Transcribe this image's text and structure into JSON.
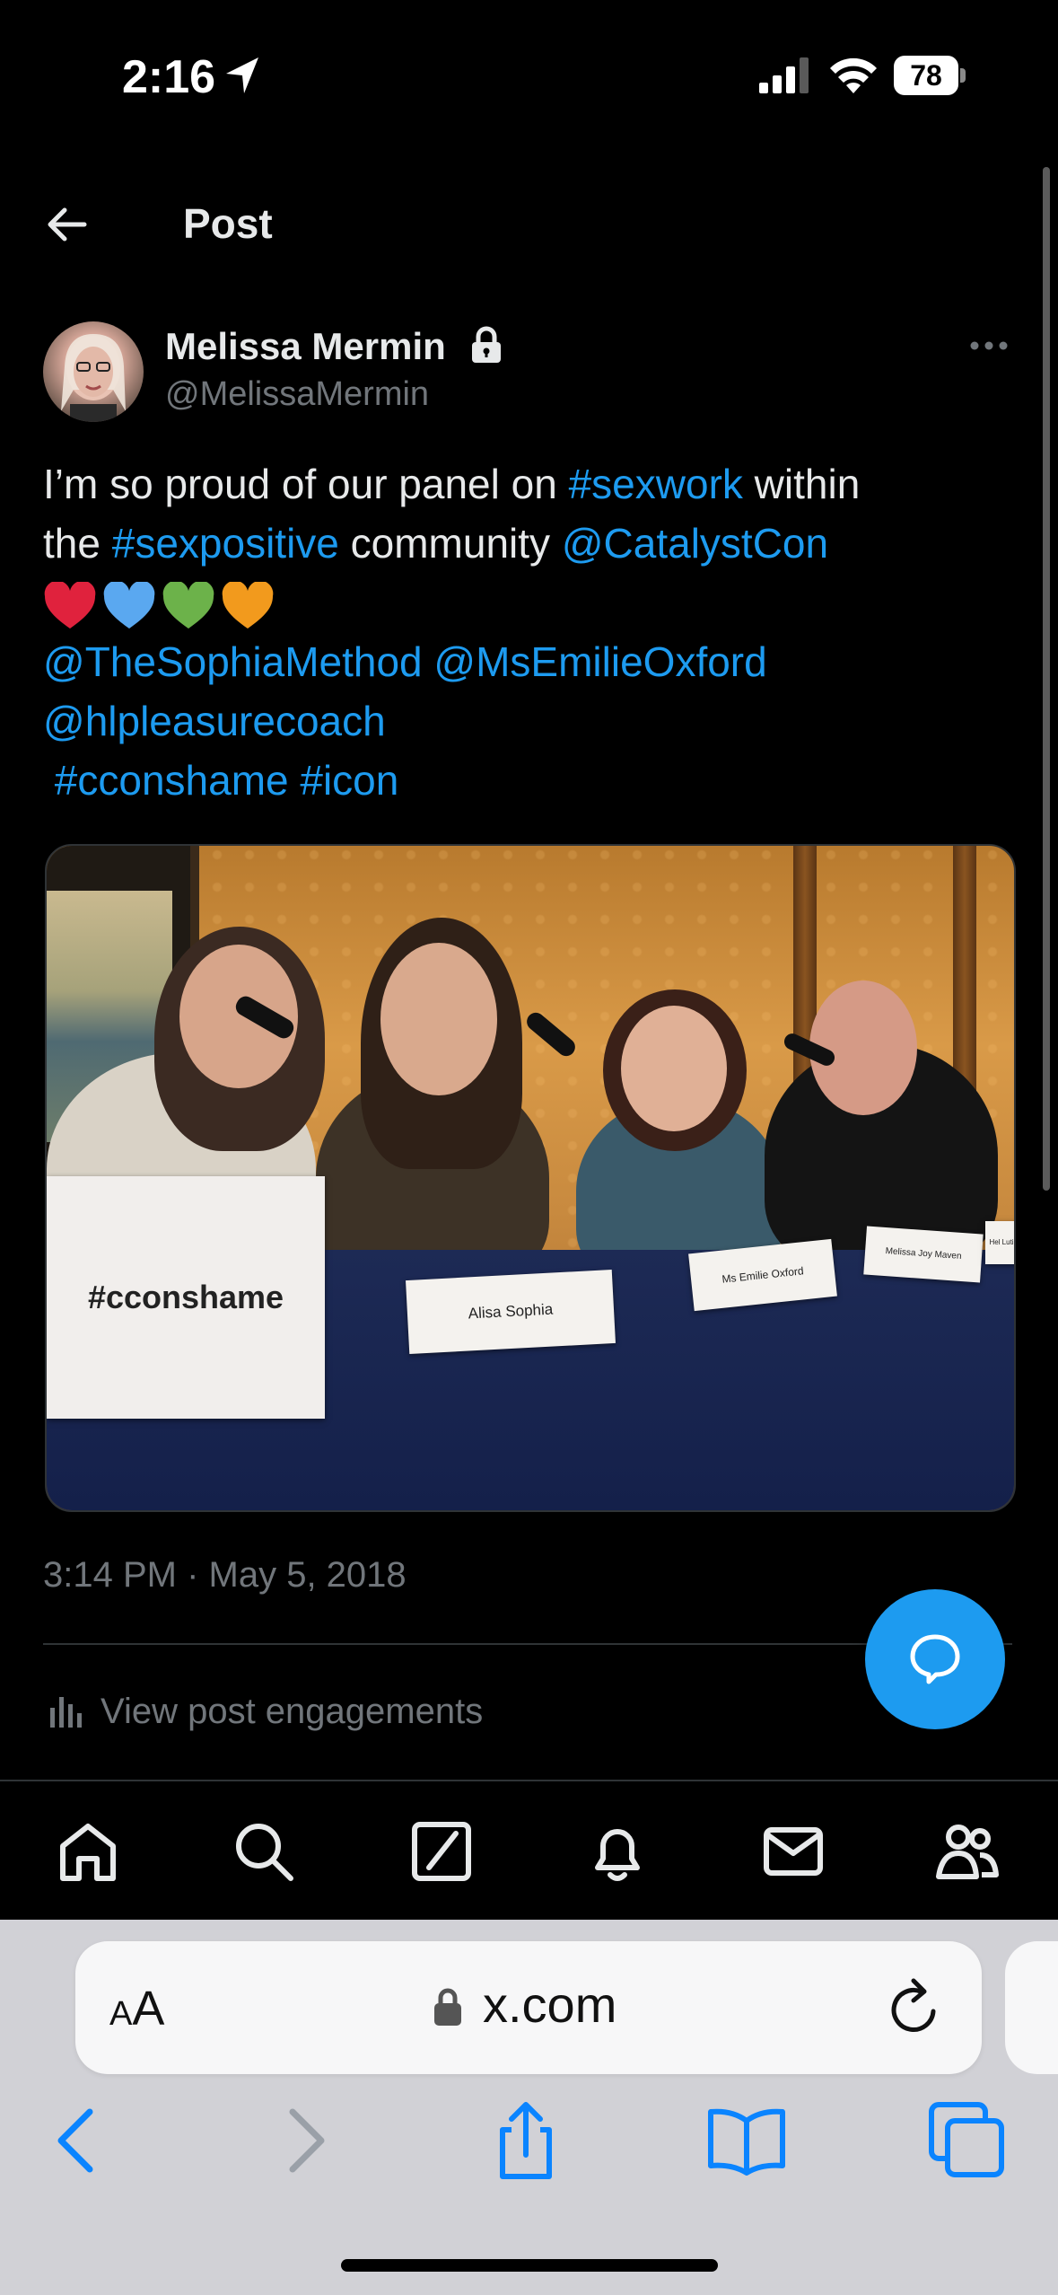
{
  "status_bar": {
    "time": "2:16",
    "battery": "78"
  },
  "header": {
    "title": "Post"
  },
  "post": {
    "author_name": "Melissa Mermin",
    "author_handle": "@MelissaMermin",
    "text": {
      "l1_a": "I’m so proud of our panel on ",
      "l1_b": "#sexwork",
      "l1_c": " within",
      "l2_a": "the ",
      "l2_b": "#sexpositive",
      "l2_c": " community ",
      "l2_d": "@CatalystCon",
      "l4": "@TheSophiaMethod @MsEmilieOxford",
      "l5": "@hlpleasurecoach",
      "l6": " #cconshame #icon"
    },
    "photo_signs": {
      "big": "#cconshame",
      "alisa": "Alisa Sophia",
      "emilie": "Ms Emilie Oxford",
      "melissa": "Melissa Joy Maven",
      "fourth": "Hel Lutis"
    },
    "timestamp": "3:14 PM · May 5, 2018",
    "engagements_label": "View post engagements"
  },
  "safari": {
    "aa_small": "A",
    "aa_big": "A",
    "url": "x.com"
  },
  "colors": {
    "link": "#1d9bf0",
    "muted": "#71767b",
    "fab": "#1d9bf0",
    "safari_accent": "#0a84ff"
  },
  "icons": [
    "location-arrow-icon",
    "signal-icon",
    "wifi-icon",
    "battery-icon",
    "back-arrow-icon",
    "lock-icon",
    "more-icon",
    "heart-icons",
    "engagements-icon",
    "compose-reply-icon",
    "home-icon",
    "search-icon",
    "grok-icon",
    "bell-icon",
    "mail-icon",
    "communities-icon",
    "reload-icon",
    "safari-back-icon",
    "safari-forward-icon",
    "share-icon",
    "bookmarks-icon",
    "tabs-icon"
  ]
}
